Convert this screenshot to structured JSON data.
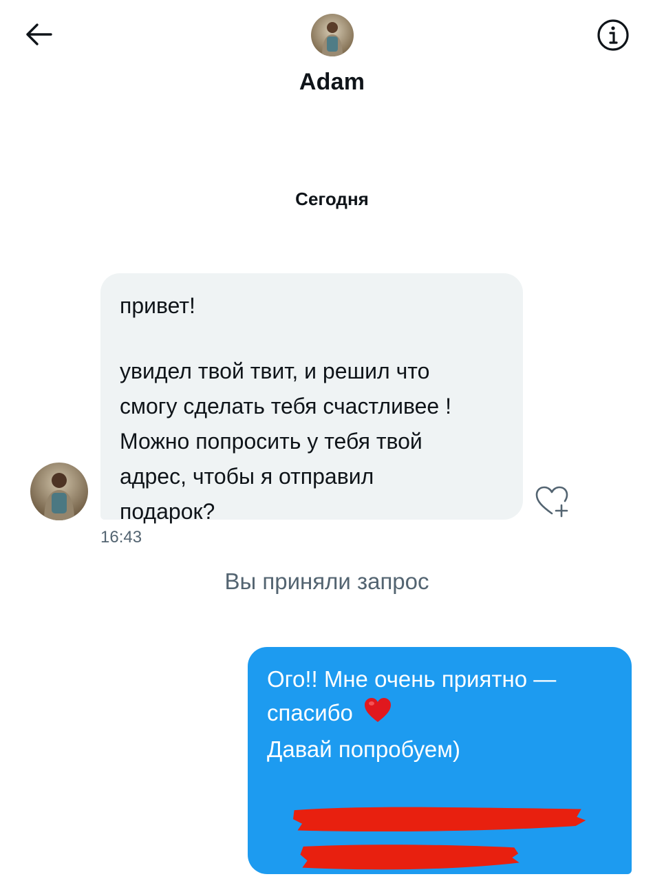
{
  "header": {
    "name": "Adam",
    "back_icon": "arrow-left-icon",
    "info_icon": "info-circle-icon"
  },
  "thread": {
    "date_label": "Сегодня",
    "incoming": {
      "lines_block1": [
        "привет!"
      ],
      "lines_block2": [
        "увидел твой твит, и решил что",
        "смогу сделать тебя счастливее !",
        "Можно попросить у тебя твой",
        "адрес, чтобы я отправил",
        "подарок?"
      ],
      "time": "16:43",
      "like_icon": "heart-plus-icon"
    },
    "system_note": "Вы приняли запрос",
    "outgoing": {
      "line1": "Ого!! Мне очень приятно —",
      "line2": "спасибо",
      "line3": "Давай попробуем)",
      "emoji": "red-heart-emoji",
      "redaction_color": "#e8200f"
    }
  },
  "colors": {
    "accent": "#1d9bf0",
    "incoming_bubble": "#eff3f4",
    "secondary_text": "#536471"
  }
}
